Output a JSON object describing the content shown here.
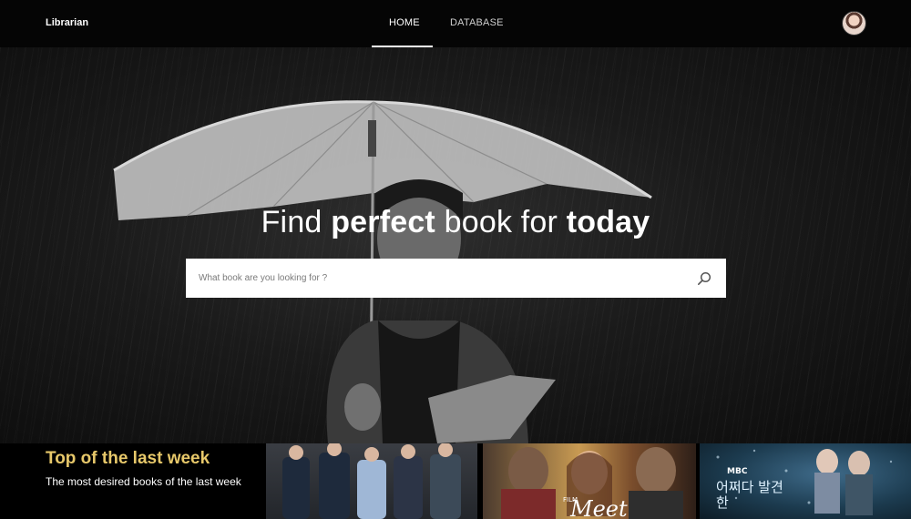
{
  "nav": {
    "brand": "Librarian",
    "links": [
      {
        "label": "HOME",
        "active": true
      },
      {
        "label": "DATABASE",
        "active": false
      }
    ],
    "avatar_icon": "user-avatar"
  },
  "hero": {
    "title_part1": "Find ",
    "title_bold1": "perfect",
    "title_part2": " book for ",
    "title_bold2": "today",
    "search": {
      "placeholder": "What book are you looking for ?",
      "value": "",
      "icon": "search-icon"
    }
  },
  "top_week": {
    "title": "Top of the last week",
    "subtitle": "The most desired books of the last week",
    "cards": [
      {
        "name": "book-cover-1",
        "label": ""
      },
      {
        "name": "book-cover-2",
        "label": "Meet",
        "prefix": "FILM"
      },
      {
        "name": "book-cover-3",
        "label": "어쩌다 발견한",
        "prefix": "MBC"
      }
    ]
  },
  "colors": {
    "accent_gold": "#e7c86a",
    "nav_bg": "#050505"
  }
}
